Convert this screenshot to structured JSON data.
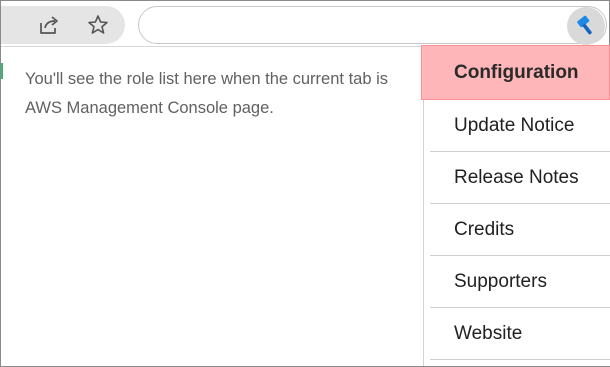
{
  "toolbar": {
    "share_icon": "share-icon",
    "star_icon": "star-icon",
    "address_value": "",
    "extension_icon": "hammer-icon"
  },
  "popup": {
    "message": "You'll see the role list here when the current tab is AWS Management Console page."
  },
  "menu": {
    "items": [
      {
        "label": "Configuration",
        "active": true
      },
      {
        "label": "Update Notice"
      },
      {
        "label": "Release Notes"
      },
      {
        "label": "Credits"
      },
      {
        "label": "Supporters"
      },
      {
        "label": "Website"
      }
    ]
  },
  "colors": {
    "active_bg": "#ffb6b8",
    "active_border": "#ff8f92",
    "extension_icon": "#1e88e5"
  }
}
